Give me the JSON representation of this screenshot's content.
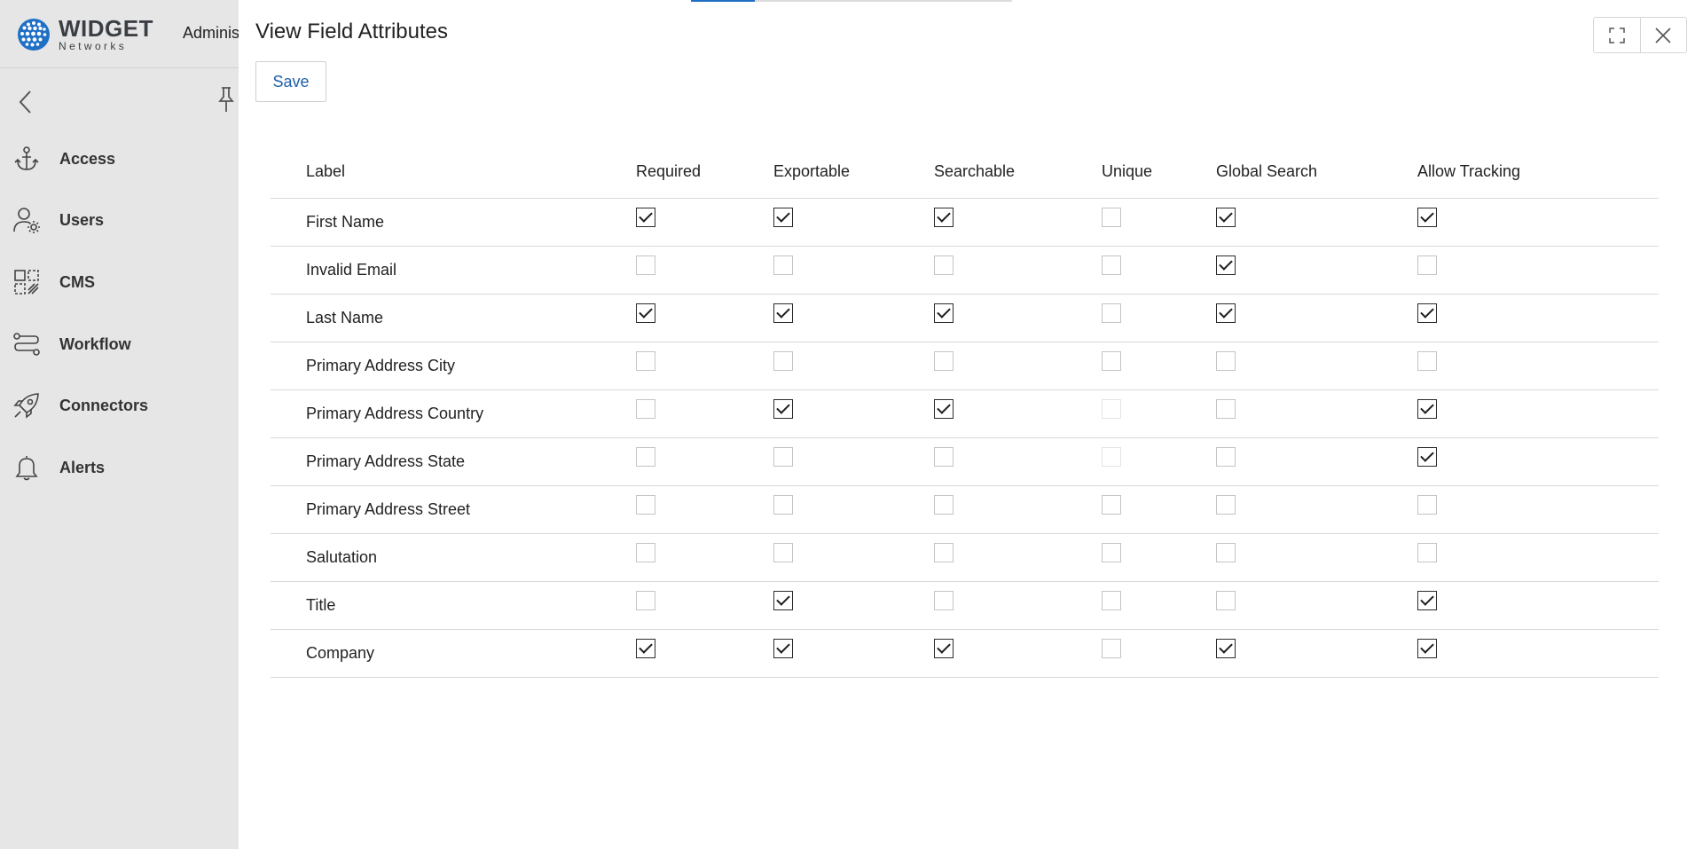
{
  "app": {
    "logo_word": "WIDGET",
    "logo_sub": "Networks",
    "section_label": "Adminis"
  },
  "sidebar": {
    "items": [
      {
        "label": "Access",
        "icon": "anchor-icon"
      },
      {
        "label": "Users",
        "icon": "user-gear-icon"
      },
      {
        "label": "CMS",
        "icon": "cms-icon"
      },
      {
        "label": "Workflow",
        "icon": "workflow-icon"
      },
      {
        "label": "Connectors",
        "icon": "rocket-icon"
      },
      {
        "label": "Alerts",
        "icon": "bell-icon"
      }
    ]
  },
  "panel": {
    "title": "View Field Attributes",
    "save_label": "Save"
  },
  "table": {
    "columns": [
      "Label",
      "Required",
      "Exportable",
      "Searchable",
      "Unique",
      "Global Search",
      "Allow Tracking"
    ],
    "rows": [
      {
        "label": "First Name",
        "values": [
          "checked",
          "checked",
          "checked",
          "unchecked",
          "checked",
          "checked"
        ]
      },
      {
        "label": "Invalid Email",
        "values": [
          "unchecked",
          "unchecked",
          "unchecked",
          "unchecked",
          "checked",
          "unchecked"
        ]
      },
      {
        "label": "Last Name",
        "values": [
          "checked",
          "checked",
          "checked",
          "unchecked",
          "checked",
          "checked"
        ]
      },
      {
        "label": "Primary Address City",
        "values": [
          "unchecked",
          "unchecked",
          "unchecked",
          "unchecked",
          "unchecked",
          "unchecked"
        ]
      },
      {
        "label": "Primary Address Country",
        "values": [
          "unchecked",
          "checked",
          "checked",
          "disabled",
          "unchecked",
          "checked"
        ]
      },
      {
        "label": "Primary Address State",
        "values": [
          "unchecked",
          "unchecked",
          "unchecked",
          "disabled",
          "unchecked",
          "checked"
        ]
      },
      {
        "label": "Primary Address Street",
        "values": [
          "unchecked",
          "unchecked",
          "unchecked",
          "unchecked",
          "unchecked",
          "unchecked"
        ]
      },
      {
        "label": "Salutation",
        "values": [
          "unchecked",
          "unchecked",
          "unchecked",
          "unchecked",
          "unchecked",
          "unchecked"
        ]
      },
      {
        "label": "Title",
        "values": [
          "unchecked",
          "checked",
          "unchecked",
          "unchecked",
          "unchecked",
          "checked"
        ]
      },
      {
        "label": "Company",
        "values": [
          "checked",
          "checked",
          "checked",
          "unchecked",
          "checked",
          "checked"
        ]
      }
    ]
  },
  "colors": {
    "accent": "#1f6fc5",
    "sidebar_bg": "#e6e6e6",
    "logo_blue": "#1f6fc5"
  }
}
